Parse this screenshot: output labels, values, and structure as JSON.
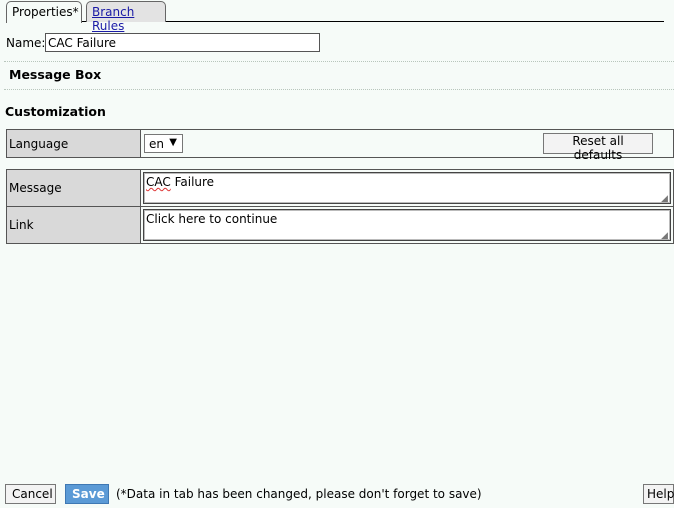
{
  "tabs": [
    {
      "label": "Properties*",
      "active": true
    },
    {
      "label": "Branch Rules",
      "active": false
    }
  ],
  "name_field": {
    "label": "Name:",
    "value": "CAC Failure"
  },
  "section_message_box": "Message Box",
  "section_customization": "Customization",
  "language": {
    "label": "Language",
    "selected": "en"
  },
  "reset_button": "Reset all defaults",
  "message": {
    "label": "Message",
    "value_prefix": "CAC",
    "value_suffix": " Failure"
  },
  "link": {
    "label": "Link",
    "value": "Click here to continue"
  },
  "footer": {
    "cancel": "Cancel",
    "save": "Save",
    "note": "(*Data in tab has been changed, please don't forget to save)",
    "help": "Help"
  },
  "colors": {
    "accent": "#5b9ad6",
    "background": "#f6fbf8",
    "label_bg": "#d9d9d9"
  }
}
